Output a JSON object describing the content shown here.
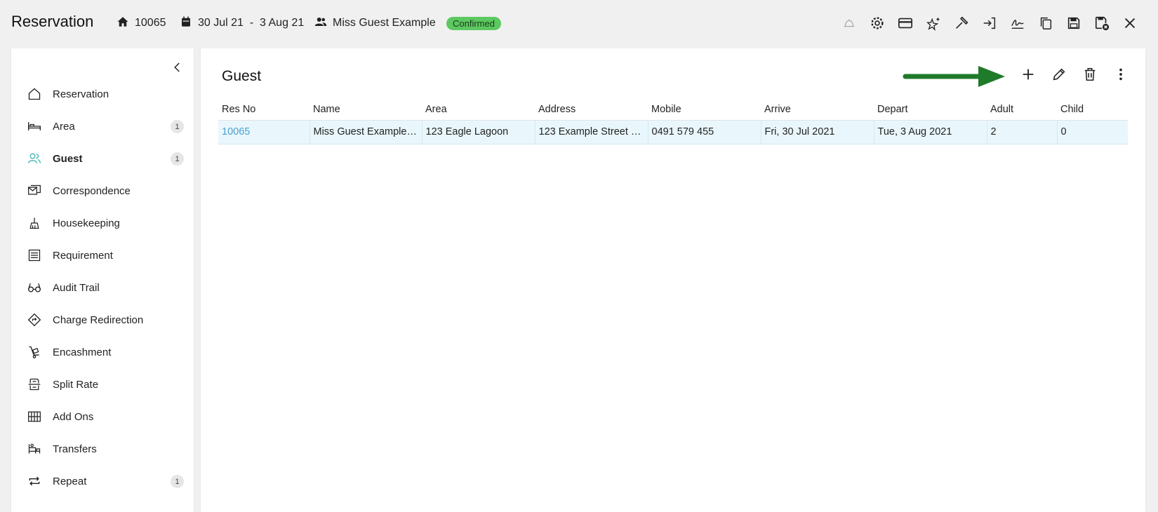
{
  "header": {
    "title": "Reservation",
    "res_no": "10065",
    "dates": "30 Jul 21  -  3 Aug 21",
    "guest_name": "Miss Guest Example",
    "status": "Confirmed",
    "status_color": "#5cc860",
    "toolbar": [
      "bell-icon",
      "settings-icon",
      "credit-card-icon",
      "sparkle-star-icon",
      "hammer-icon",
      "check-in-icon",
      "signature-icon",
      "copy-icon",
      "save-icon",
      "save-close-icon",
      "close-icon"
    ]
  },
  "sidebar": {
    "items": [
      {
        "label": "Reservation",
        "icon": "home-icon",
        "count": ""
      },
      {
        "label": "Area",
        "icon": "bed-icon",
        "count": "1"
      },
      {
        "label": "Guest",
        "icon": "guests-icon",
        "count": "1",
        "active": true
      },
      {
        "label": "Correspondence",
        "icon": "correspondence-icon",
        "count": ""
      },
      {
        "label": "Housekeeping",
        "icon": "housekeeping-icon",
        "count": ""
      },
      {
        "label": "Requirement",
        "icon": "requirement-icon",
        "count": ""
      },
      {
        "label": "Audit Trail",
        "icon": "glasses-icon",
        "count": ""
      },
      {
        "label": "Charge Redirection",
        "icon": "redirect-icon",
        "count": ""
      },
      {
        "label": "Encashment",
        "icon": "trolley-icon",
        "count": ""
      },
      {
        "label": "Split Rate",
        "icon": "split-rate-icon",
        "count": ""
      },
      {
        "label": "Add Ons",
        "icon": "grid-icon",
        "count": ""
      },
      {
        "label": "Transfers",
        "icon": "transfers-icon",
        "count": ""
      },
      {
        "label": "Repeat",
        "icon": "repeat-icon",
        "count": "1"
      }
    ]
  },
  "panel": {
    "title": "Guest",
    "columns": [
      "Res No",
      "Name",
      "Area",
      "Address",
      "Mobile",
      "Arrive",
      "Depart",
      "Adult",
      "Child"
    ],
    "rows": [
      [
        "10065",
        "Miss Guest Example (...",
        "123 Eagle Lagoon",
        "123 Example Street E...",
        "0491 579 455",
        "Fri, 30 Jul 2021",
        "Tue, 3 Aug 2021",
        "2",
        "0"
      ]
    ]
  },
  "colors": {
    "accent": "#3ab5b0",
    "link": "#4a9fd0",
    "row_highlight": "#e9f7fd",
    "annotation_arrow": "#1f7a2a"
  }
}
